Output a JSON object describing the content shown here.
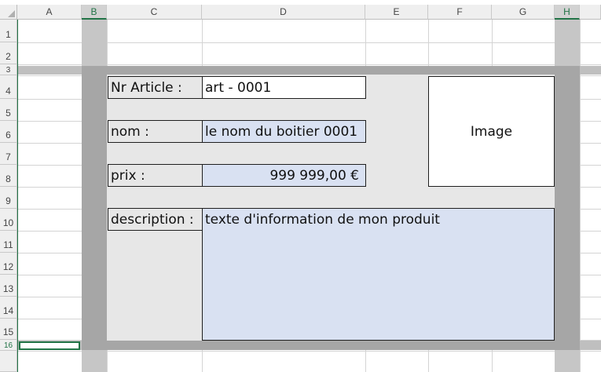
{
  "sheet": {
    "columns": [
      "A",
      "B",
      "C",
      "D",
      "E",
      "F",
      "G",
      "H"
    ],
    "rows": [
      "1",
      "2",
      "3",
      "4",
      "5",
      "6",
      "7",
      "8",
      "9",
      "10",
      "11",
      "12",
      "13",
      "14",
      "15",
      "16"
    ],
    "selected_columns": [
      "B",
      "H"
    ],
    "selected_rows": [
      "16"
    ]
  },
  "card": {
    "article_label": "Nr Article :",
    "article_value": "art - 0001",
    "name_label": "nom :",
    "name_value": "le nom du boitier 0001",
    "price_label": "prix :",
    "price_value": "999 999,00 €",
    "description_label": "description :",
    "description_value": "texte d'information de mon produit",
    "image_label": "Image"
  },
  "colors": {
    "card_background": "#e7e7e7",
    "input_blue": "#d9e1f2",
    "frame_dark": "#a6a6a6",
    "selection_green": "#217346"
  }
}
